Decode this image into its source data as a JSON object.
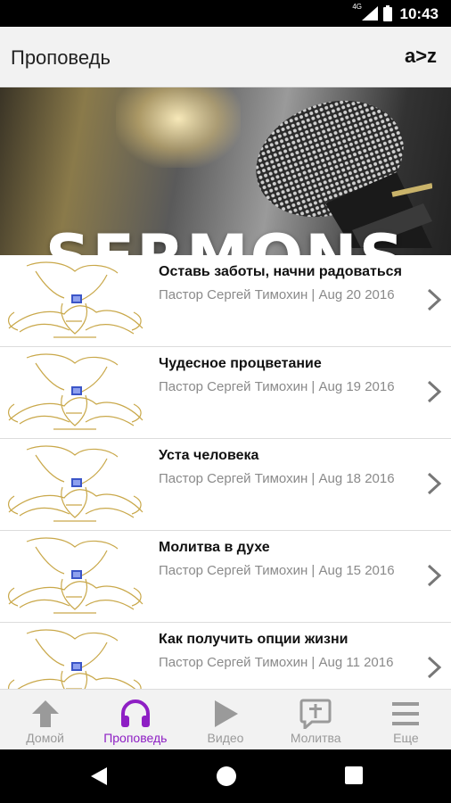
{
  "status_bar": {
    "time": "10:43",
    "network": "4G"
  },
  "app_bar": {
    "title": "Проповедь",
    "az_label": "a>z"
  },
  "banner": {
    "title": "SERMONS"
  },
  "sermons": [
    {
      "title": "Оставь заботы, начни радоваться",
      "meta": "Пастор Сергей Тимохин | Aug 20 2016"
    },
    {
      "title": "Чудесное процветание",
      "meta": "Пастор Сергей Тимохин | Aug 19 2016"
    },
    {
      "title": "Уста человека",
      "meta": "Пастор Сергей Тимохин | Aug 18 2016"
    },
    {
      "title": "Молитва в духе",
      "meta": "Пастор Сергей Тимохин | Aug 15 2016"
    },
    {
      "title": "Как получить опции жизни",
      "meta": "Пастор Сергей Тимохин | Aug 11 2016"
    }
  ],
  "tabs": [
    {
      "label": "Домой",
      "icon": "arrow-up-icon",
      "active": false
    },
    {
      "label": "Проповедь",
      "icon": "headphones-icon",
      "active": true
    },
    {
      "label": "Видео",
      "icon": "play-icon",
      "active": false
    },
    {
      "label": "Молитва",
      "icon": "prayer-bubble-icon",
      "active": false
    },
    {
      "label": "Еще",
      "icon": "menu-icon",
      "active": false
    }
  ],
  "colors": {
    "accent": "#8e1fc4",
    "inactive": "#9a9a9a",
    "thumb_line": "#c9a84a"
  }
}
